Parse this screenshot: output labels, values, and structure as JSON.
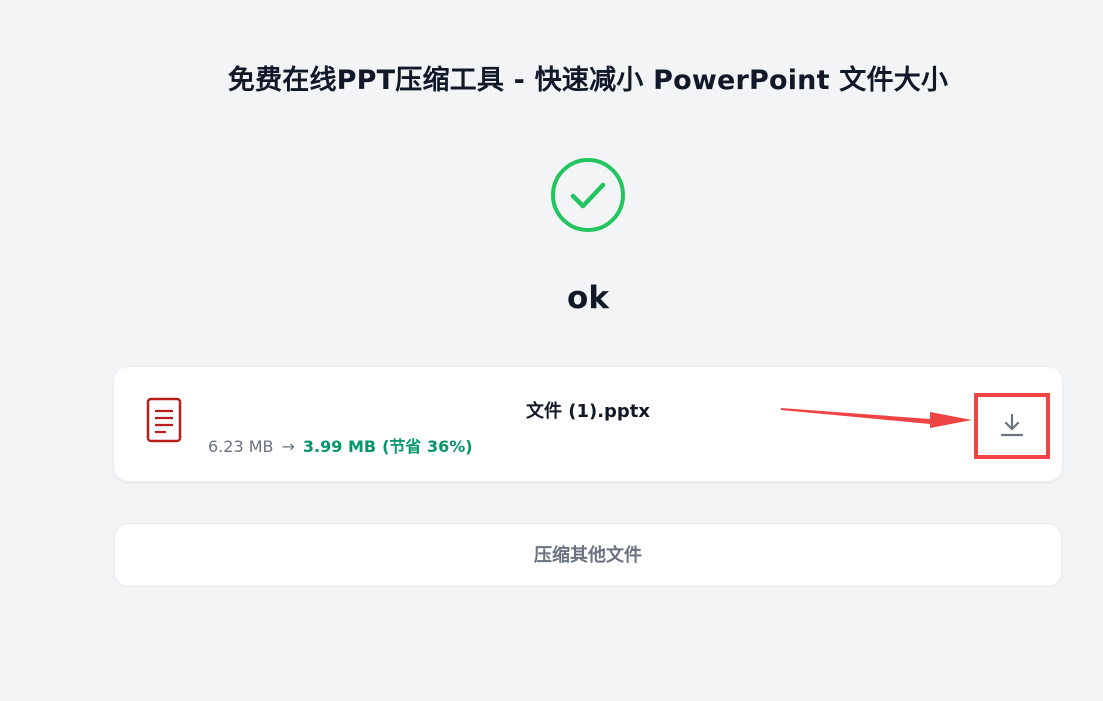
{
  "header": {
    "title": "免费在线PPT压缩工具 - 快速减小 PowerPoint 文件大小"
  },
  "result": {
    "status_icon": "check-circle-icon",
    "status_text": "ok"
  },
  "file": {
    "icon": "document-icon",
    "name": "文件 (1).pptx",
    "original_size": "6.23 MB",
    "arrow": "→",
    "compressed_size": "3.99 MB",
    "savings": "(节省 36%)",
    "download_icon": "download-icon"
  },
  "actions": {
    "compress_other_label": "压缩其他文件"
  },
  "colors": {
    "background": "#f3f4f6",
    "success": "#22c55e",
    "savings_text": "#059669",
    "file_icon": "#b91c1c",
    "annotation": "#ef4444"
  }
}
